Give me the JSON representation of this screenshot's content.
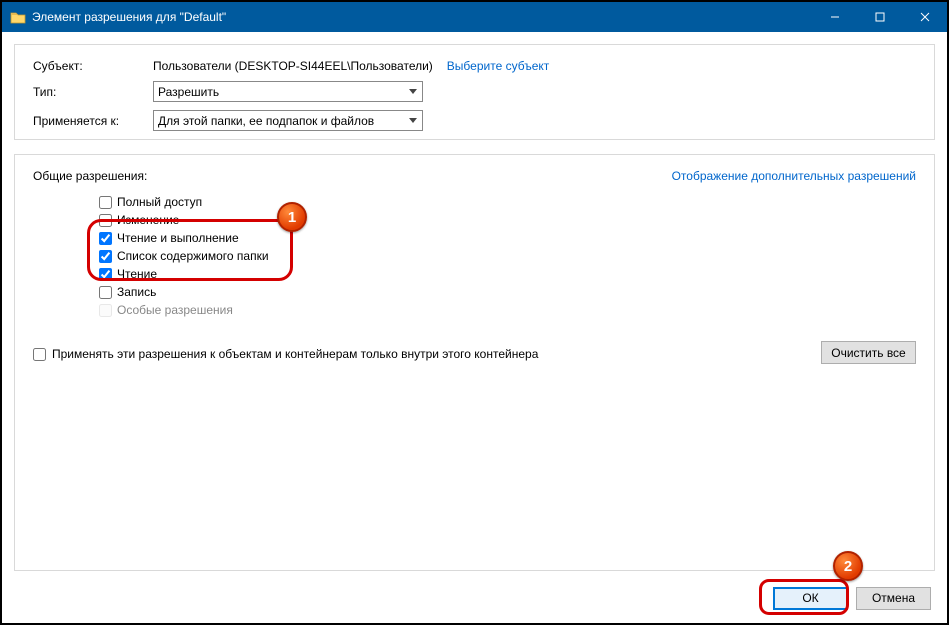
{
  "window": {
    "title": "Элемент разрешения для \"Default\""
  },
  "subject": {
    "label": "Субъект:",
    "value": "Пользователи (DESKTOP-SI44EEL\\Пользователи)",
    "select_link": "Выберите субъект"
  },
  "type": {
    "label": "Тип:",
    "value": "Разрешить"
  },
  "applies": {
    "label": "Применяется к:",
    "value": "Для этой папки, ее подпапок и файлов"
  },
  "perms": {
    "header": "Общие разрешения:",
    "advanced_link": "Отображение дополнительных разрешений",
    "items": {
      "full": {
        "label": "Полный доступ",
        "checked": false
      },
      "modify": {
        "label": "Изменение",
        "checked": false
      },
      "read_exec": {
        "label": "Чтение и выполнение",
        "checked": true
      },
      "list": {
        "label": "Список содержимого папки",
        "checked": true
      },
      "read": {
        "label": "Чтение",
        "checked": true
      },
      "write": {
        "label": "Запись",
        "checked": false
      },
      "special": {
        "label": "Особые разрешения",
        "checked": false
      }
    }
  },
  "apply_only": {
    "label": "Применять эти разрешения к объектам и контейнерам только внутри этого контейнера",
    "checked": false
  },
  "buttons": {
    "clear_all": "Очистить все",
    "ok": "ОК",
    "cancel": "Отмена"
  },
  "annotations": {
    "badge1": "1",
    "badge2": "2"
  }
}
